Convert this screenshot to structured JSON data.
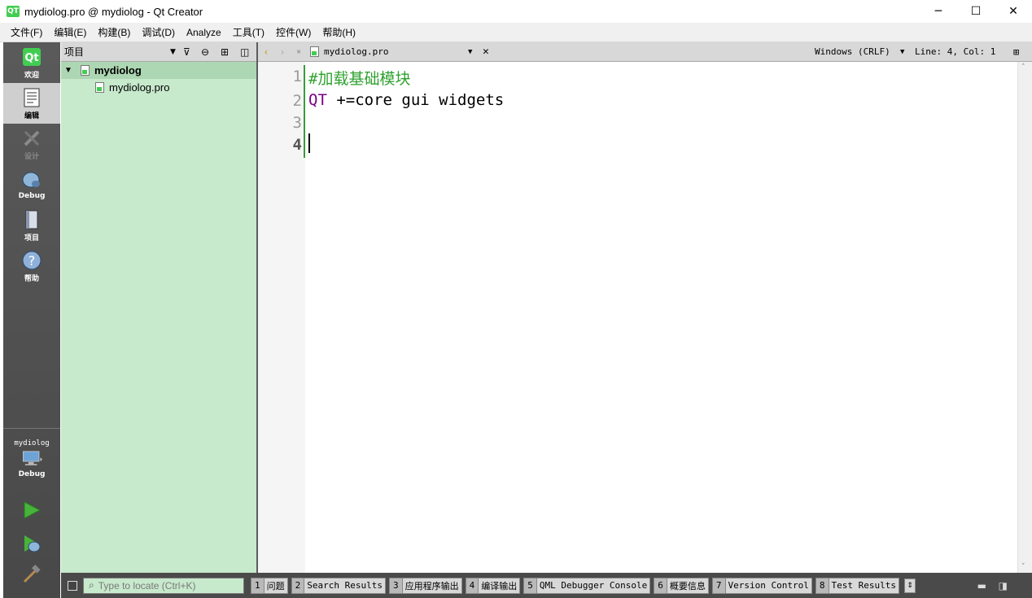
{
  "window": {
    "app_icon_text": "QT",
    "title": "mydiolog.pro @ mydiolog - Qt Creator",
    "minimize_glyph": "─",
    "maximize_glyph": "☐",
    "close_glyph": "✕"
  },
  "menu": [
    "文件(F)",
    "编辑(E)",
    "构建(B)",
    "调试(D)",
    "Analyze",
    "工具(T)",
    "控件(W)",
    "帮助(H)"
  ],
  "modes": [
    {
      "label": "欢迎",
      "icon": "qt-logo-icon"
    },
    {
      "label": "编辑",
      "icon": "document-edit-icon",
      "active": true
    },
    {
      "label": "设计",
      "icon": "design-pencil-icon",
      "disabled": true
    },
    {
      "label": "Debug",
      "icon": "debug-bug-icon"
    },
    {
      "label": "项目",
      "icon": "project-book-icon"
    },
    {
      "label": "帮助",
      "icon": "help-question-icon"
    }
  ],
  "kit": {
    "project": "mydiolog",
    "build": "Debug"
  },
  "projects_pane": {
    "title": "项目",
    "tree": [
      {
        "label": "mydiolog",
        "level": 0,
        "expanded": true,
        "bold": true
      },
      {
        "label": "mydiolog.pro",
        "level": 1
      }
    ]
  },
  "editor_toolbar": {
    "file_name": "mydiolog.pro",
    "line_ending": "Windows (CRLF)",
    "position": "Line: 4, Col: 1"
  },
  "editor": {
    "current_line": 4,
    "lines": [
      {
        "num": "1",
        "text": "#加载基础模块",
        "style": "comment"
      },
      {
        "num": "2",
        "kw": "QT",
        "text": " +=core gui widgets"
      },
      {
        "num": "3",
        "text": ""
      },
      {
        "num": "4",
        "text": ""
      }
    ]
  },
  "bottom": {
    "locator_placeholder": "Type to locate (Ctrl+K)",
    "output_panes": [
      {
        "num": "1",
        "label": "问题"
      },
      {
        "num": "2",
        "label": "Search Results"
      },
      {
        "num": "3",
        "label": "应用程序输出"
      },
      {
        "num": "4",
        "label": "编译输出"
      },
      {
        "num": "5",
        "label": "QML Debugger Console"
      },
      {
        "num": "6",
        "label": "概要信息"
      },
      {
        "num": "7",
        "label": "Version Control"
      },
      {
        "num": "8",
        "label": "Test Results"
      }
    ]
  }
}
